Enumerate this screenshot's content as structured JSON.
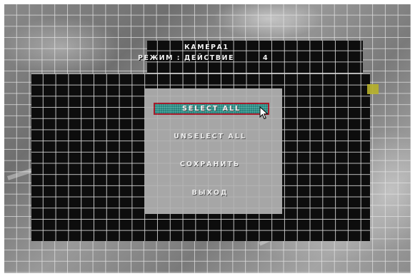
{
  "osd": {
    "camera_title": "КАМЕРА1",
    "mode_label": "РЕЖИМ : ДЕЙСТВИЕ",
    "mode_value": "4"
  },
  "menu": {
    "items": [
      {
        "label": "SELECT ALL",
        "selected": true
      },
      {
        "label": "UNSELECT ALL",
        "selected": false
      },
      {
        "label": "СОХРАНИТЬ",
        "selected": false
      },
      {
        "label": "ВЫХОД",
        "selected": false
      }
    ]
  },
  "colors": {
    "mask": "#0d0d0d",
    "grid_lines": "#dcdcdc",
    "menu_panel": "#b4b4b4",
    "highlight_fill": "#2e8f88",
    "highlight_border": "#b21e2e",
    "selected_cell": "#b7b12a"
  },
  "icons": {
    "cursor": "mouse-pointer-icon"
  }
}
